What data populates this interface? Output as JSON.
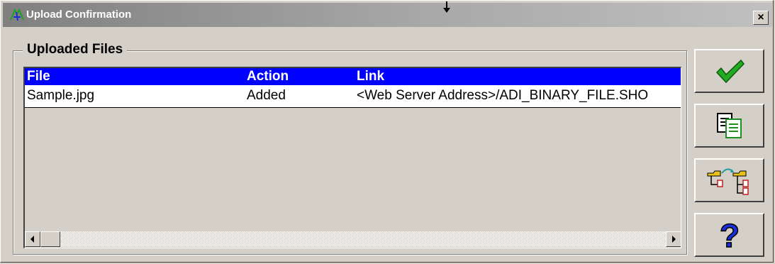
{
  "window": {
    "title": "Upload Confirmation",
    "close_label": "×"
  },
  "group": {
    "label": "Uploaded Files"
  },
  "table": {
    "columns": [
      "File",
      "Action",
      "Link"
    ],
    "rows": [
      [
        "Sample.jpg",
        "Added",
        "<Web Server Address>/ADI_BINARY_FILE.SHO"
      ]
    ]
  },
  "toolbar": {
    "buttons": [
      {
        "name": "ok",
        "icon": "checkmark-icon"
      },
      {
        "name": "copy",
        "icon": "copy-icon"
      },
      {
        "name": "transfer",
        "icon": "transfer-files-icon"
      },
      {
        "name": "help",
        "icon": "help-icon"
      }
    ]
  },
  "colors": {
    "header_bg": "#0000ff",
    "title_gradient_start": "#808080",
    "face": "#d4d0c8",
    "check": "#22aa22",
    "help": "#1a2fd6"
  }
}
